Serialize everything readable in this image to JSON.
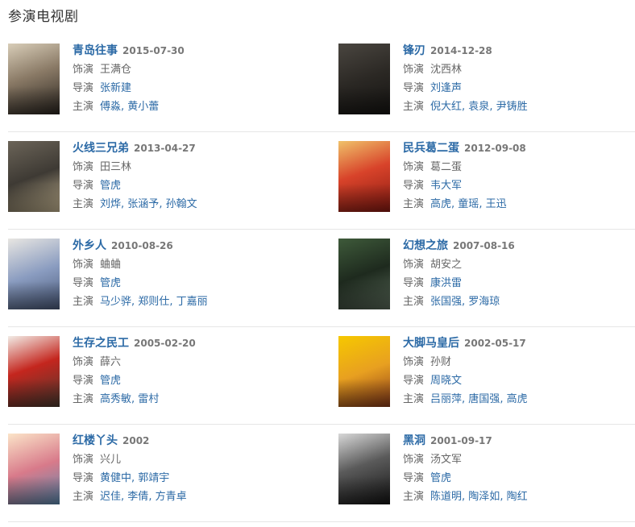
{
  "section_title": "参演电视剧",
  "labels": {
    "role": "饰演",
    "director": "导演",
    "cast": "主演"
  },
  "shows": [
    {
      "title": "青岛往事",
      "date": "2015-07-30",
      "role": "王满仓",
      "director": [
        "张新建"
      ],
      "cast": [
        "傅淼",
        "黄小蕾"
      ],
      "poster_bg": "linear-gradient(160deg,#d8cdb8 0%,#8a7a66 45%,#2a2520 100%)"
    },
    {
      "title": "锋刃",
      "date": "2014-12-28",
      "role": "沈西林",
      "director": [
        "刘逢声"
      ],
      "cast": [
        "倪大红",
        "袁泉",
        "尹铸胜"
      ],
      "poster_bg": "linear-gradient(160deg,#4a4640 0%,#2b2824 50%,#151412 100%)"
    },
    {
      "title": "火线三兄弟",
      "date": "2013-04-27",
      "role": "田三林",
      "director": [
        "管虎"
      ],
      "cast": [
        "刘烨",
        "张涵予",
        "孙翰文"
      ],
      "poster_bg": "linear-gradient(160deg,#6b6458 0%,#3e3a34 50%,#c8b894 100%)"
    },
    {
      "title": "民兵葛二蛋",
      "date": "2012-09-08",
      "role": "葛二蛋",
      "director": [
        "韦大军"
      ],
      "cast": [
        "高虎",
        "童瑶",
        "王迅"
      ],
      "poster_bg": "linear-gradient(160deg,#f0c26a 0%,#d8432a 45%,#8a1a12 100%)"
    },
    {
      "title": "外乡人",
      "date": "2010-08-26",
      "role": "蛐蛐",
      "director": [
        "管虎"
      ],
      "cast": [
        "马少骅",
        "郑则仕",
        "丁嘉丽"
      ],
      "poster_bg": "linear-gradient(160deg,#e8e6e2 0%,#8a9cc0 50%,#4a5a7a 100%)"
    },
    {
      "title": "幻想之旅",
      "date": "2007-08-16",
      "role": "胡安之",
      "director": [
        "康洪雷"
      ],
      "cast": [
        "张国强",
        "罗海琼"
      ],
      "poster_bg": "linear-gradient(160deg,#3e5a3a 0%,#1e2a1e 50%,#5a6a5a 100%)"
    },
    {
      "title": "生存之民工",
      "date": "2005-02-20",
      "role": "薛六",
      "director": [
        "管虎"
      ],
      "cast": [
        "高秀敏",
        "雷村"
      ],
      "poster_bg": "linear-gradient(160deg,#f2ece6 0%,#c4261e 45%,#4a3a30 100%)"
    },
    {
      "title": "大脚马皇后",
      "date": "2002-05-17",
      "role": "孙财",
      "director": [
        "周晓文"
      ],
      "cast": [
        "吕丽萍",
        "唐国强",
        "高虎"
      ],
      "poster_bg": "linear-gradient(160deg,#f6c800 0%,#e8a020 50%,#8a3a1a 100%)"
    },
    {
      "title": "红楼丫头",
      "date": "2002",
      "role": "兴儿",
      "director": [
        "黄健中",
        "郭靖宇"
      ],
      "cast": [
        "迟佳",
        "李倩",
        "方青卓"
      ],
      "poster_bg": "linear-gradient(160deg,#fbe4c8 0%,#d87a8a 50%,#5a8ab0 100%)"
    },
    {
      "title": "黑洞",
      "date": "2001-09-17",
      "role": "汤文军",
      "director": [
        "管虎"
      ],
      "cast": [
        "陈道明",
        "陶泽如",
        "陶红"
      ],
      "poster_bg": "linear-gradient(160deg,#d8d8d8 0%,#5a5a5a 45%,#141414 100%)"
    }
  ]
}
